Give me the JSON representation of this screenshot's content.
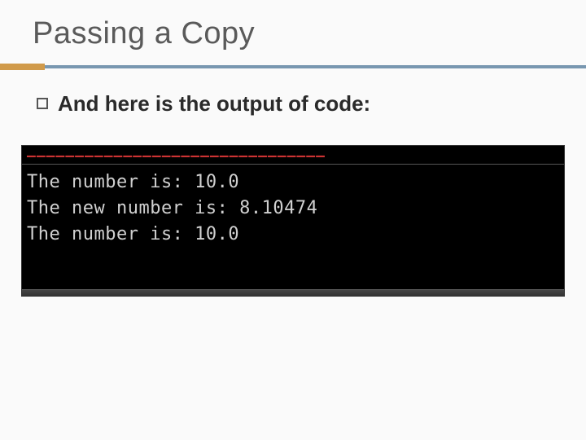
{
  "title": "Passing a Copy",
  "bullet": {
    "text": "And here is the output of code:"
  },
  "terminal": {
    "red_header_fragment": "———————————————————————————————",
    "lines": [
      "The number is: 10.0",
      "The new number is: 8.10474",
      "The number is: 10.0"
    ]
  }
}
